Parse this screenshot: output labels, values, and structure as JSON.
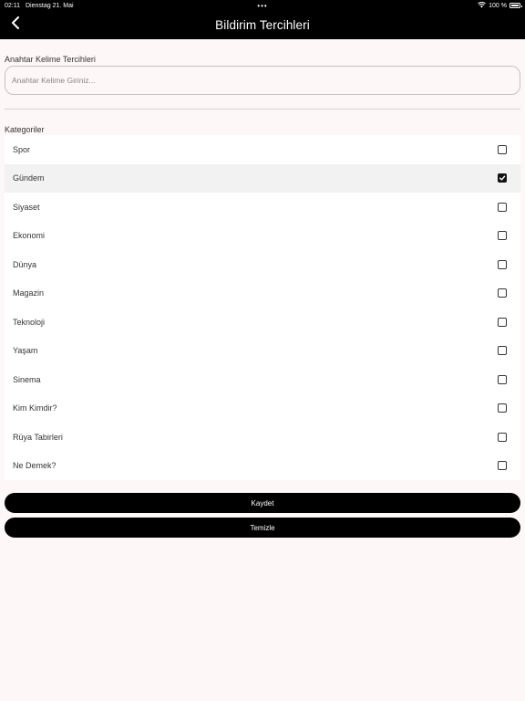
{
  "status": {
    "time": "02:11",
    "date": "Dienstag 21. Mai",
    "dots": "•••",
    "battery": "100 %",
    "wifi_icon": "wifi-icon",
    "battery_icon": "battery-icon"
  },
  "nav": {
    "title": "Bildirim Tercihleri",
    "back_icon": "chevron-left-icon"
  },
  "keywords": {
    "label": "Anahtar Kelime Tercihleri",
    "placeholder": "Anahtar Kelime Giriniz...",
    "value": ""
  },
  "categories": {
    "label": "Kategoriler",
    "items": [
      {
        "label": "Spor",
        "checked": false
      },
      {
        "label": "Gündem",
        "checked": true
      },
      {
        "label": "Siyaset",
        "checked": false
      },
      {
        "label": "Ekonomi",
        "checked": false
      },
      {
        "label": "Dünya",
        "checked": false
      },
      {
        "label": "Magazin",
        "checked": false
      },
      {
        "label": "Teknoloji",
        "checked": false
      },
      {
        "label": "Yaşam",
        "checked": false
      },
      {
        "label": "Sinema",
        "checked": false
      },
      {
        "label": "Kim Kimdir?",
        "checked": false
      },
      {
        "label": "Rüya Tabirleri",
        "checked": false
      },
      {
        "label": "Ne Demek?",
        "checked": false
      }
    ]
  },
  "actions": {
    "save_label": "Kaydet",
    "clear_label": "Temizle"
  },
  "colors": {
    "bar": "#000000",
    "background": "#fdf8f7",
    "selected_row": "#f2f2f2"
  }
}
